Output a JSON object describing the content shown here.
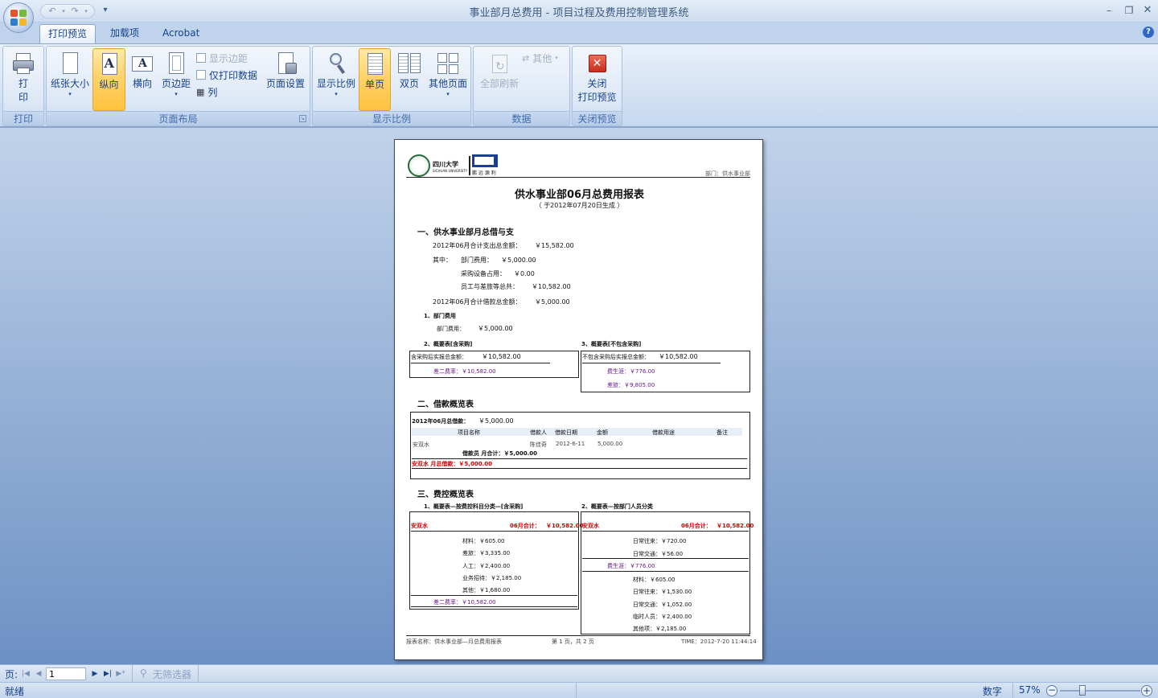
{
  "window": {
    "title": "事业部月总费用 - 项目过程及费用控制管理系统"
  },
  "tabs": [
    {
      "label": "打印预览",
      "active": true
    },
    {
      "label": "加载项",
      "active": false
    },
    {
      "label": "Acrobat",
      "active": false
    }
  ],
  "ribbon": {
    "groups": {
      "print": {
        "label": "打印",
        "print_button": "打\n印"
      },
      "layout": {
        "label": "页面布局",
        "paper_size": "纸张大小",
        "portrait": "纵向",
        "landscape": "横向",
        "margins": "页边距",
        "show_margins": "显示边距",
        "print_data_only": "仅打印数据",
        "columns": "列",
        "page_setup": "页面设置"
      },
      "zoom": {
        "label": "显示比例",
        "zoom": "显示比例",
        "one_page": "单页",
        "two_pages": "双页",
        "more_pages": "其他页面"
      },
      "data": {
        "label": "数据",
        "refresh_all": "全部刷新",
        "other": "其他"
      },
      "close": {
        "label": "关闭预览",
        "close_preview": "关闭\n打印预览"
      }
    }
  },
  "report": {
    "logo_text": "四川大学",
    "logo_subtext": "SICHUAN UNIVERSITY",
    "logo_company": "鹏 远 源 利",
    "department_label": "部门：供水事业部",
    "title": "供水事业部06月总费用报表",
    "subtitle": "（    于2012年07月20日生成    ）",
    "section1": {
      "heading": "一、供水事业部月总借与支",
      "total_expense_label": "2012年06月合计支出总金额：",
      "total_expense": "￥15,582.00",
      "among": "其中：",
      "dept_fee_label": "部门费用：",
      "dept_fee": "￥5,000.00",
      "equip_label": "采购设备占用：",
      "equip": "￥0.00",
      "staff_label": "员工与差旅等总共：",
      "staff": "￥10,582.00",
      "borrow_total_label": "2012年06月合计借款总金额：",
      "borrow_total": "￥5,000.00",
      "sub1": "1、部门费用",
      "sub1_label": "部门费用：",
      "sub1_value": "￥5,000.00",
      "sub2": "2、概要表[含采购]",
      "sub3": "3、概要表[不包含采购]",
      "sub2_row_label": "含采购后实报总金额：",
      "sub2_row_value": "￥10,582.00",
      "sub2_total": "差二费率：￥10,582.00",
      "sub3_row_label": "不包含采购后实报总金额：",
      "sub3_row_value": "￥10,582.00",
      "sub3_l1": "费生涯：￥776.00",
      "sub3_l2": "差旅：￥9,805.00"
    },
    "section2": {
      "heading": "二、借款概览表",
      "month_borrow_label": "2012年06月总借款：",
      "month_borrow": "￥5,000.00",
      "columns": [
        "项目名称",
        "借款人",
        "借款日期",
        "金额",
        "借款用途",
        "备注"
      ],
      "row": [
        "安双水",
        "陈佳奇",
        "2012-6-11",
        "5,000.00",
        "",
        ""
      ],
      "subtotal": "借款员 月合计：￥5,000.00",
      "total": "安双水 月总借款：￥5,000.00"
    },
    "section3": {
      "heading": "三、费控概览表",
      "left_title": "1、概要表—按费控科目分类—[含采购]",
      "right_title": "2、概要表—按部门人员分类",
      "left_header_name": "安双水",
      "left_header_month": "06月合计：",
      "left_header_value": "￥10,582.00",
      "left_items": [
        "材料：￥605.00",
        "差旅：￥3,335.00",
        "人工：￥2,400.00",
        "业务招待：￥2,185.00",
        "其他：￥1,680.00"
      ],
      "left_total": "差二费率：￥10,582.00",
      "right_header_name": "安双水",
      "right_header_month": "06月合计：",
      "right_header_value": "￥10,582.00",
      "right_top_items": [
        "日常往来：￥720.00",
        "日常交通：￥56.00"
      ],
      "right_mid": "费生涯：￥776.00",
      "right_items": [
        "材料：￥605.00",
        "日常往来：￥1,530.00",
        "日常交通：￥1,052.00",
        "临时人员：￥2,400.00",
        "其他项：￥2,185.00"
      ]
    },
    "footer": {
      "report_name": "报表名称：供水事业部—月总费用报表",
      "page_info": "第 1 页，共 2 页",
      "time": "TIME：2012-7-20  11:44:14"
    }
  },
  "navigation": {
    "page_label": "页:",
    "page_value": "1",
    "filter": "无筛选器"
  },
  "status": {
    "left": "就绪",
    "mode": "数字",
    "zoom": "57%"
  },
  "colors": {
    "workspace_top": "#c1d3ea",
    "workspace_bottom": "#6d90c4",
    "selected_button": "#ffd36b",
    "report_red": "#d40000",
    "report_purple": "#6a1a8c"
  }
}
